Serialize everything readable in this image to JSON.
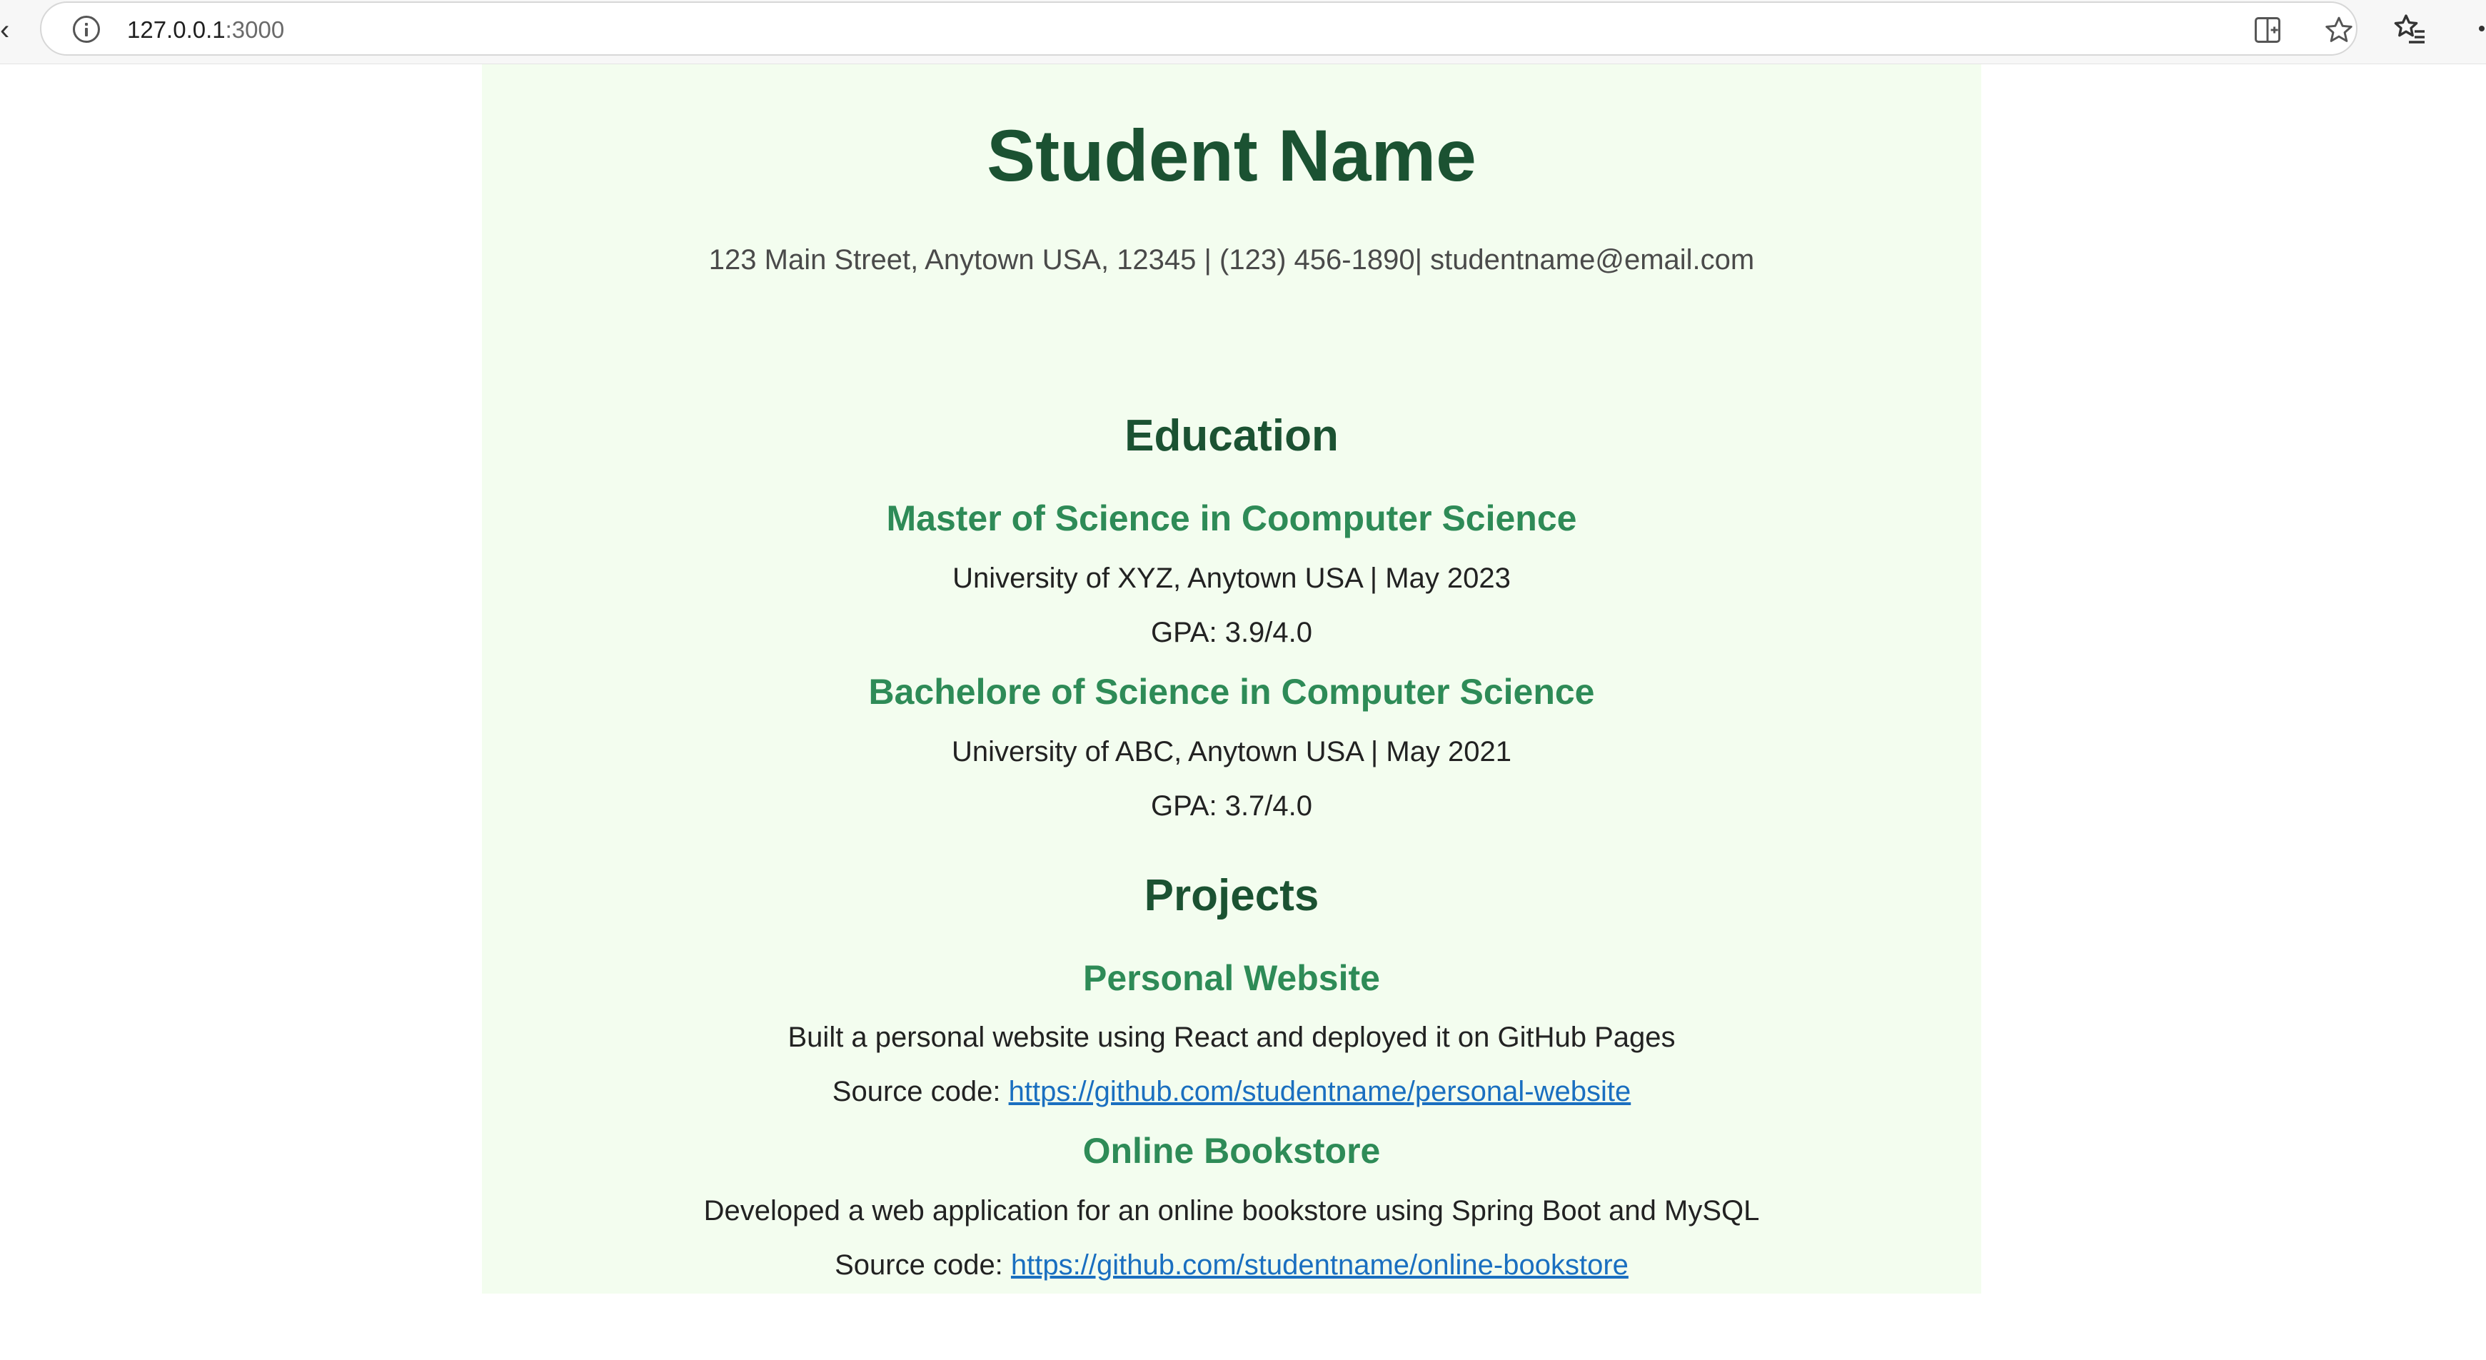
{
  "browser": {
    "url_host": "127.0.0.1",
    "url_port": ":3000"
  },
  "resume": {
    "name": "Student Name",
    "contact": "123 Main Street, Anytown USA, 12345 | (123) 456-1890| studentname@email.com",
    "education": {
      "title": "Education",
      "items": [
        {
          "degree": "Master of Science in Coomputer Science",
          "school": "University of XYZ, Anytown USA | May 2023",
          "gpa": "GPA: 3.9/4.0"
        },
        {
          "degree": "Bachelore of Science in Computer Science",
          "school": "University of ABC, Anytown USA | May 2021",
          "gpa": "GPA: 3.7/4.0"
        }
      ]
    },
    "projects": {
      "title": "Projects",
      "items": [
        {
          "name": "Personal Website",
          "description": "Built a personal website using React and deployed it on GitHub Pages",
          "source_label": "Source code: ",
          "source_url": "https://github.com/studentname/personal-website"
        },
        {
          "name": "Online Bookstore",
          "description": "Developed a web application for an online bookstore using Spring Boot and MySQL",
          "source_label": "Source code: ",
          "source_url": "https://github.com/studentname/online-bookstore"
        }
      ]
    }
  },
  "colors": {
    "heading": "#1b5232",
    "subheading": "#2e8b57",
    "link": "#1a6fc0",
    "page_bg": "#f3fdef"
  },
  "icons": {
    "site_info": "info-icon",
    "split_screen": "split-screen-icon",
    "favorite": "star-icon",
    "favorites_bar": "favorites-icon",
    "more": "more-icon"
  }
}
